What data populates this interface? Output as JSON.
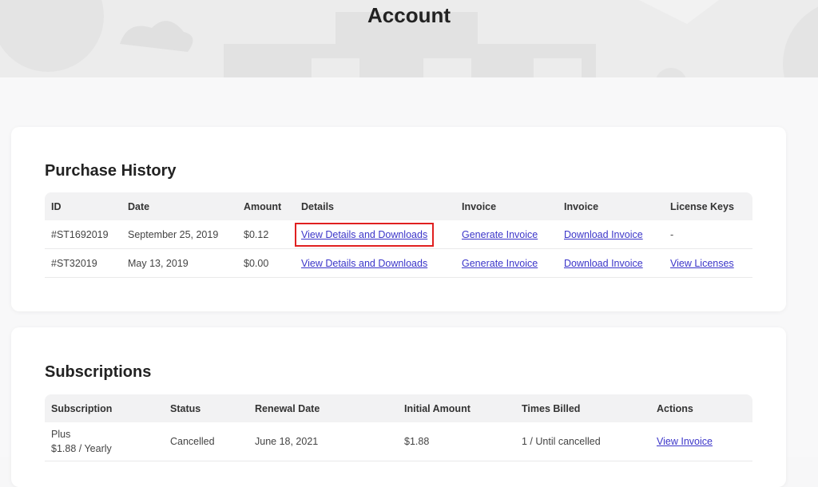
{
  "page": {
    "title": "Account"
  },
  "purchase_history": {
    "title": "Purchase History",
    "columns": [
      "ID",
      "Date",
      "Amount",
      "Details",
      "Invoice",
      "Invoice",
      "License Keys"
    ],
    "rows": [
      {
        "id": "#ST1692019",
        "date": "September 25, 2019",
        "amount": "$0.12",
        "details": "View Details and Downloads",
        "invoice_generate": "Generate Invoice",
        "invoice_download": "Download Invoice",
        "license": "-"
      },
      {
        "id": "#ST32019",
        "date": "May 13, 2019",
        "amount": "$0.00",
        "details": "View Details and Downloads",
        "invoice_generate": "Generate Invoice",
        "invoice_download": "Download Invoice",
        "license": "View Licenses"
      }
    ]
  },
  "subscriptions": {
    "title": "Subscriptions",
    "columns": [
      "Subscription",
      "Status",
      "Renewal Date",
      "Initial Amount",
      "Times Billed",
      "Actions"
    ],
    "rows": [
      {
        "name": "Plus",
        "plan": "$1.88 / Yearly",
        "status": "Cancelled",
        "renewal": "June 18, 2021",
        "initial": "$1.88",
        "billed": "1 / Until cancelled",
        "action": "View Invoice"
      }
    ]
  },
  "colors": {
    "link": "#3b35c9",
    "highlight": "#e02020",
    "hero_bg": "#ececec"
  }
}
